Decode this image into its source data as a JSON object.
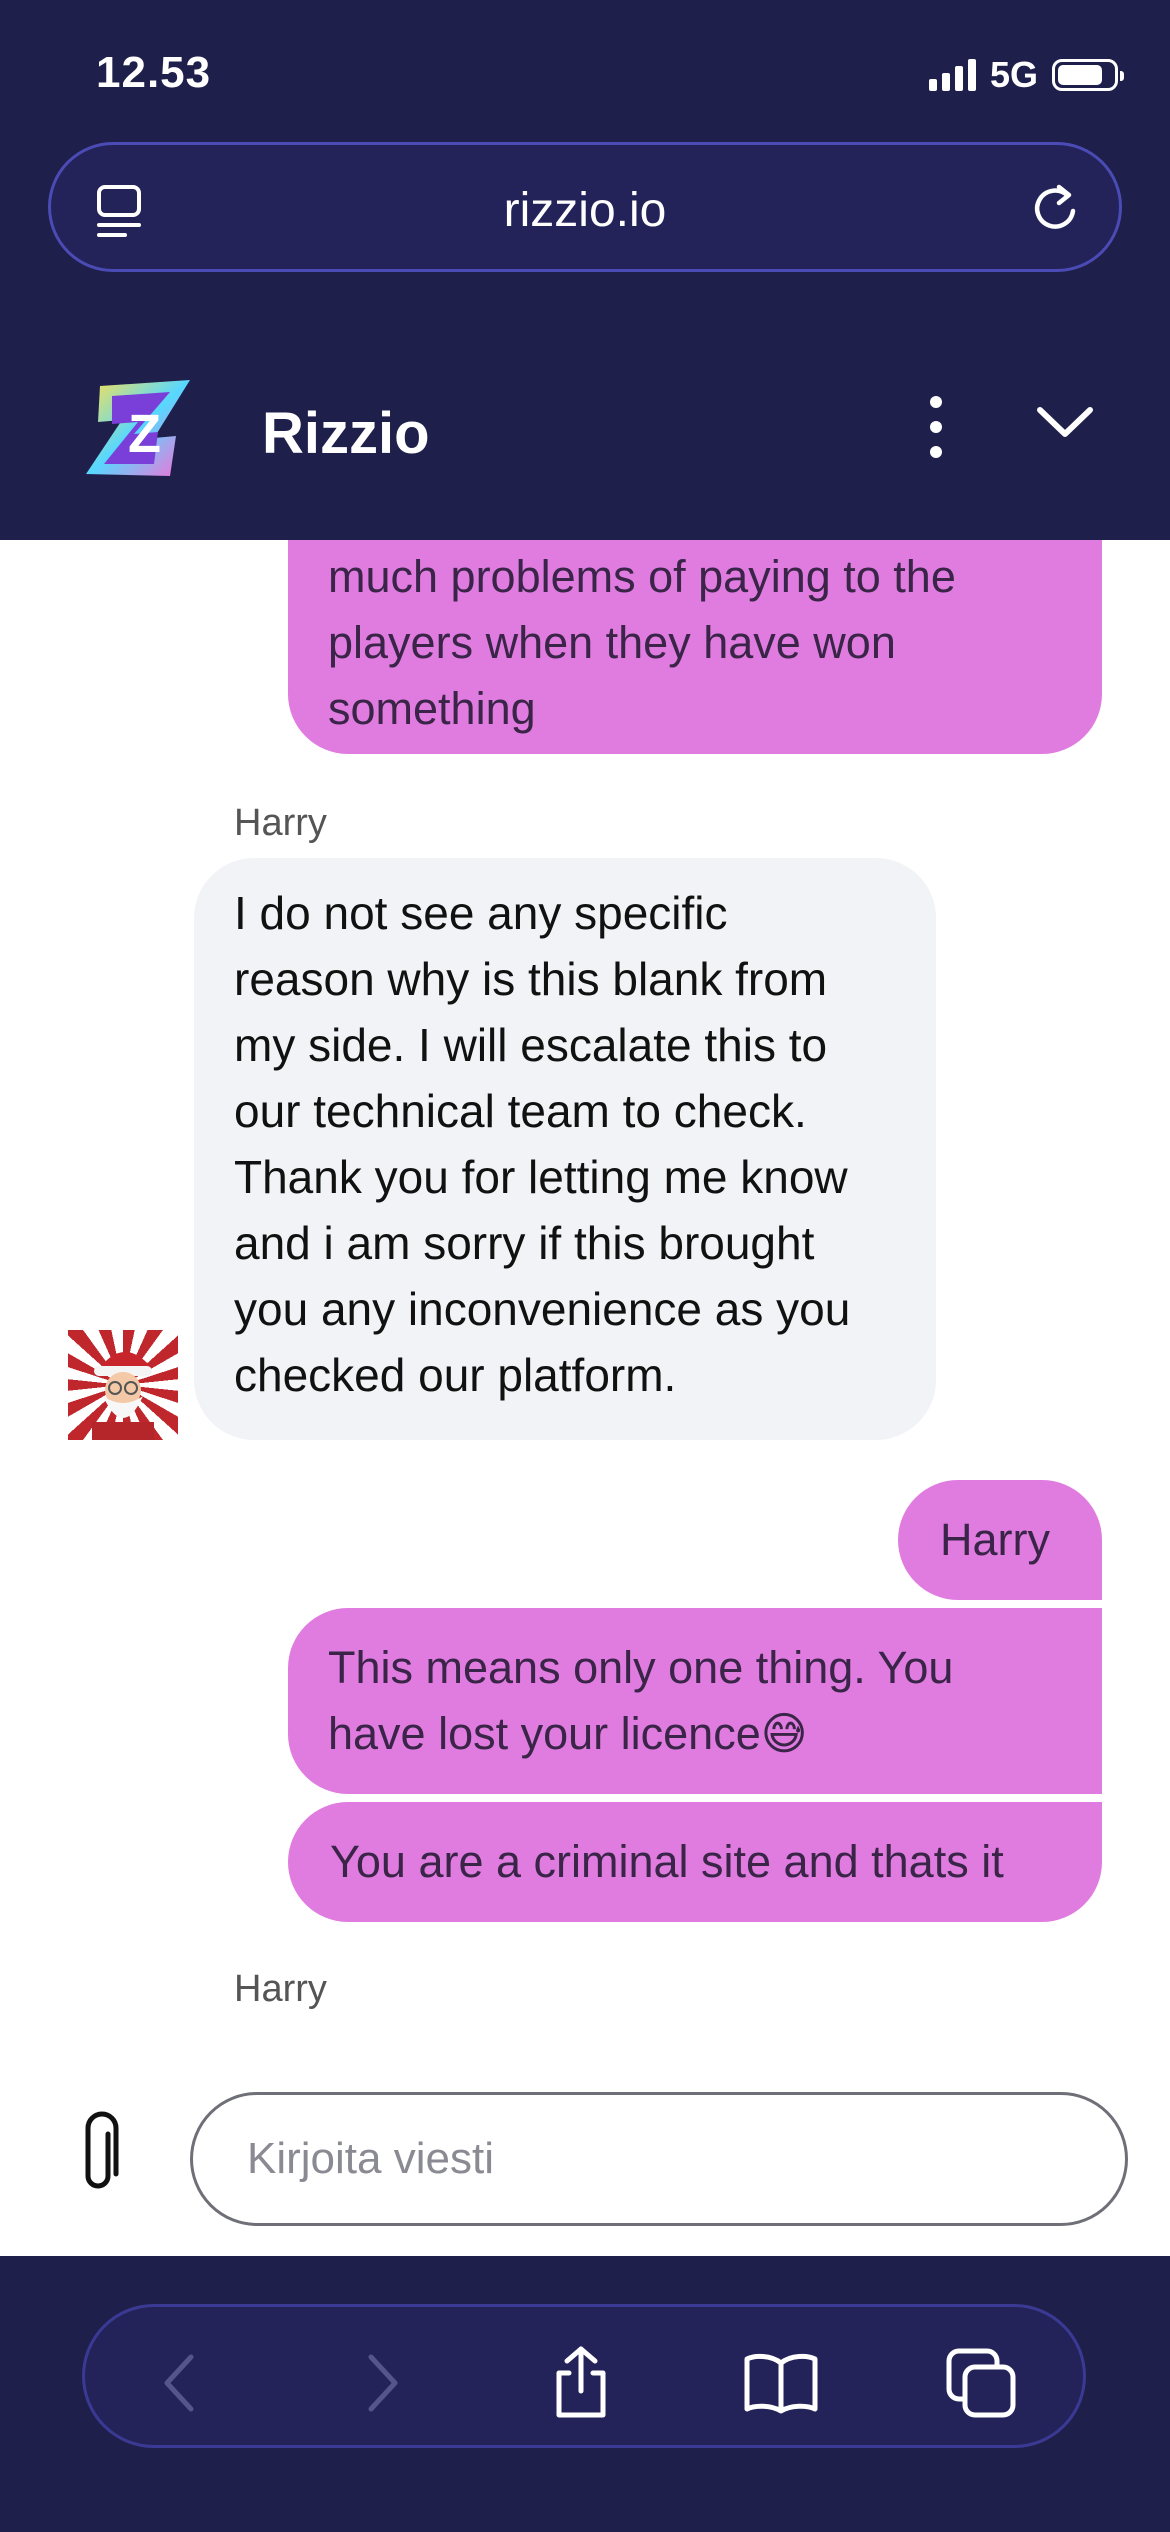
{
  "status": {
    "time": "12.53",
    "network": "5G"
  },
  "browser": {
    "url": "rizzio.io"
  },
  "app": {
    "title": "Rizzio"
  },
  "messages": {
    "out_top_lines": [
      "much problems of paying to the",
      "players when they have won",
      "something"
    ],
    "agent_name": "Harry",
    "agent_lines": [
      "I do not see any specific",
      "reason why is this blank from",
      "my side. I will escalate this to",
      "our technical team to check.",
      "Thank you for letting me know",
      "and i am sorry if this brought",
      "you any inconvenience as you",
      "checked our platform."
    ],
    "out_harry": "Harry",
    "out_licence_lines": [
      "This means only one thing. You",
      "have lost your licence😅"
    ],
    "out_criminal": "You are a criminal site and thats it",
    "agent_name_2": "Harry"
  },
  "composer": {
    "placeholder": "Kirjoita viesti"
  },
  "colors": {
    "chrome": "#1f1f4b",
    "outgoing_bubble": "#e07ce0",
    "incoming_bubble": "#f2f3f6"
  },
  "icons": {
    "url_left": "tab-list-icon",
    "reload": "reload-icon",
    "logo": "rizzio-logo",
    "menu": "kebab-menu-icon",
    "collapse": "chevron-down-icon",
    "attach": "paperclip-icon",
    "back": "back-icon",
    "forward": "forward-icon",
    "share": "share-icon",
    "bookmarks": "bookmarks-icon",
    "tabs": "tabs-icon"
  }
}
